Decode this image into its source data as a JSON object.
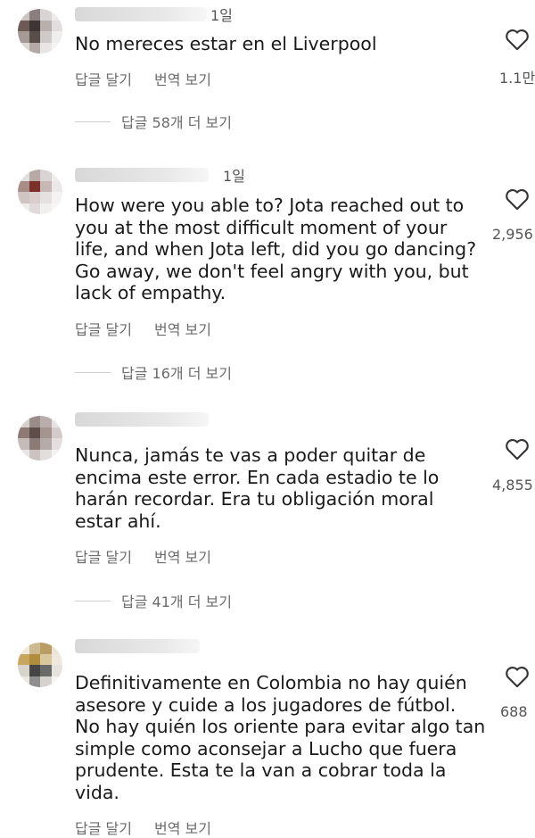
{
  "comments": [
    {
      "time": "1일",
      "text": "No mereces estar en el Liverpool",
      "reply_label": "답글 달기",
      "translate_label": "번역 보기",
      "likes": "1.1만",
      "more_replies": "답글 58개 더 보기"
    },
    {
      "time": "1일",
      "text": "How were you able to? Jota reached out to\nyou at the most difficult moment of your\nlife, and when Jota left, did you go dancing?\nGo away, we don't feel angry with you, but\nlack of empathy.",
      "reply_label": "답글 달기",
      "translate_label": "번역 보기",
      "likes": "2,956",
      "more_replies": "답글 16개 더 보기"
    },
    {
      "time": "",
      "text": "Nunca, jamás te vas a poder quitar de\nencima este error. En cada estadio te lo\nharán recordar. Era tu obligación moral\nestar ahí.",
      "reply_label": "답글 달기",
      "translate_label": "번역 보기",
      "likes": "4,855",
      "more_replies": "답글 41개 더 보기"
    },
    {
      "time": "",
      "text": "Definitivamente en Colombia no hay quién\nasesore y cuide a los jugadores de fútbol.\nNo hay quién los oriente para evitar algo tan\nsimple como aconsejar a Lucho que fuera\nprudente. Esta te la van a cobrar toda la\nvida.",
      "reply_label": "답글 달기",
      "translate_label": "번역 보기",
      "likes": "688",
      "more_replies": ""
    }
  ],
  "icons": {
    "like": "heart-outline-icon"
  },
  "colors": {
    "text": "#1a1a1a",
    "secondary": "#6b6b6b"
  }
}
